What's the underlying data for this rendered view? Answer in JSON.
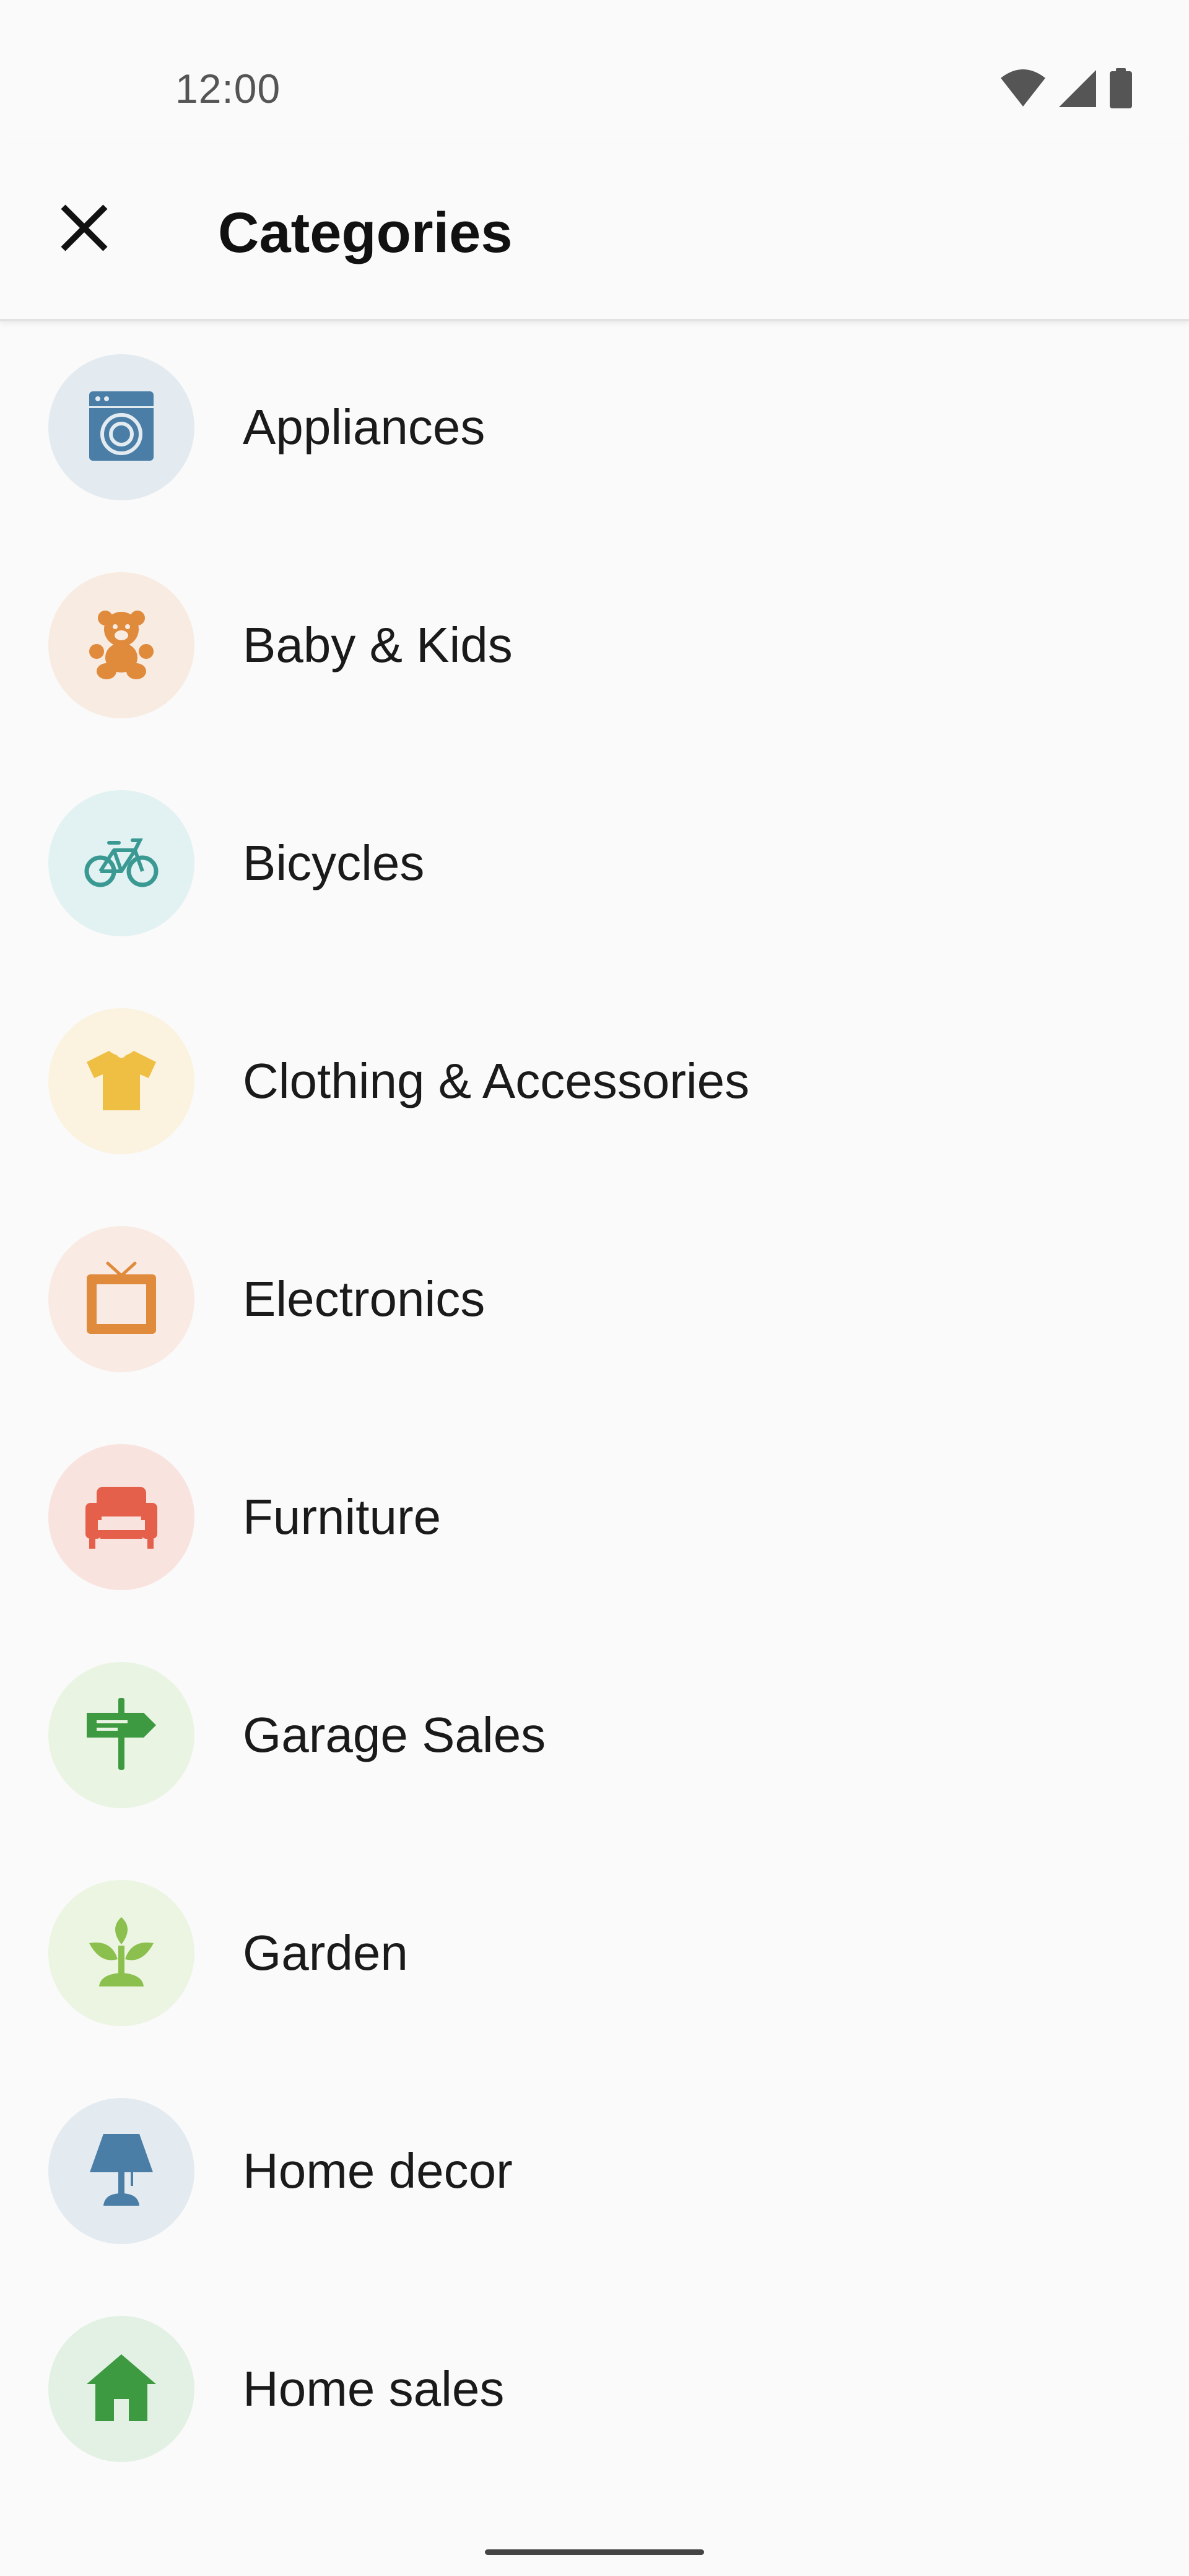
{
  "status_bar": {
    "time": "12:00",
    "icons": [
      "wifi-icon",
      "cellular-signal-icon",
      "battery-icon"
    ]
  },
  "app_bar": {
    "close_icon": "close-icon",
    "title": "Categories"
  },
  "categories": [
    {
      "label": "Appliances",
      "icon": "washing-machine-icon",
      "bg": "#e3ebf1",
      "fg": "#4a7ea6"
    },
    {
      "label": "Baby & Kids",
      "icon": "teddy-bear-icon",
      "bg": "#f8ebe1",
      "fg": "#e08a3c"
    },
    {
      "label": "Bicycles",
      "icon": "bicycle-icon",
      "bg": "#e2f1f1",
      "fg": "#3a9a93"
    },
    {
      "label": "Clothing & Accessories",
      "icon": "t-shirt-icon",
      "bg": "#fbf3e0",
      "fg": "#efbf43"
    },
    {
      "label": "Electronics",
      "icon": "television-icon",
      "bg": "#f9ebe3",
      "fg": "#e08a3c"
    },
    {
      "label": "Furniture",
      "icon": "armchair-icon",
      "bg": "#f9e3df",
      "fg": "#e5604a"
    },
    {
      "label": "Garage Sales",
      "icon": "signpost-icon",
      "bg": "#eaf4e3",
      "fg": "#3d9a40"
    },
    {
      "label": "Garden",
      "icon": "sprout-icon",
      "bg": "#ecf4e2",
      "fg": "#8cc04e"
    },
    {
      "label": "Home decor",
      "icon": "lamp-icon",
      "bg": "#e3ebf1",
      "fg": "#4a7ea6"
    },
    {
      "label": "Home sales",
      "icon": "house-icon",
      "bg": "#e2f1e4",
      "fg": "#3d9a40"
    }
  ]
}
